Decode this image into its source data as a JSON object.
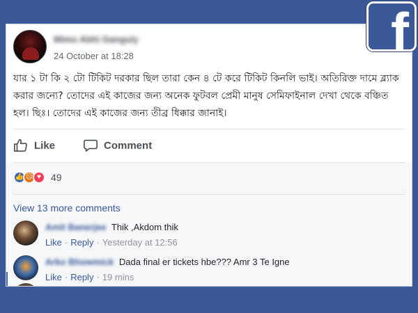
{
  "post": {
    "author": "Mimo Abhi Ganguly",
    "timestamp": "24 October at 18:28",
    "body": "যার ১ টা কি ২ টো টিকিট দরকার ছিল তারা কেন ৪ টে করে টিকিট কিনলি ভাই। অতিরিক্ত দামে ব্ল্যাক করার জন্যে? তোদের এই কাজের জন্য অনেক ফুটবল প্রেমী মানুষ সেমিফাইনাল দেখা থেকে বঞ্চিত হল। ছিঃ। তোদের এই কাজের জন্য তীব্র ধিক্কার জানাই।"
  },
  "actions": {
    "like": "Like",
    "comment": "Comment"
  },
  "reactions": {
    "count": "49",
    "icons": [
      "like-icon",
      "angry-icon",
      "love-icon"
    ]
  },
  "comments": {
    "view_more": "View 13 more comments",
    "items": [
      {
        "name": "Amit Banerjee",
        "text": "Thik ,Akdom thik",
        "like": "Like",
        "reply": "Reply",
        "time": "Yesterday at 12:56"
      },
      {
        "name": "Arko Bhowmick",
        "text": "Dada final er tickets hbe??? Amr 3 Te Igne",
        "like": "Like",
        "reply": "Reply",
        "time": "19 mins"
      }
    ]
  },
  "brand": {
    "logo": "f",
    "color": "#3b5998"
  }
}
